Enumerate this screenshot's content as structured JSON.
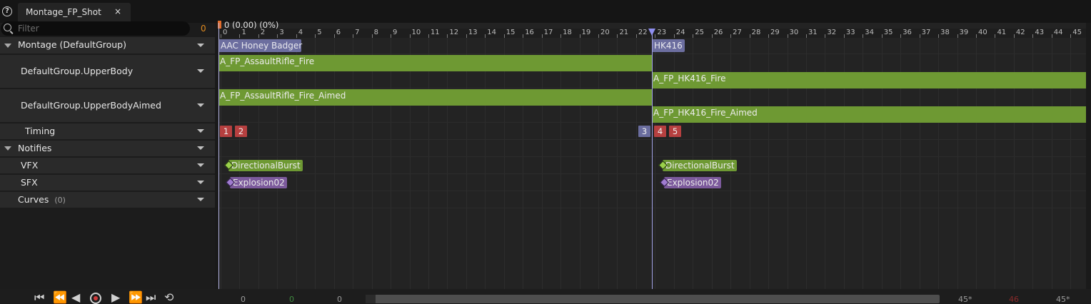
{
  "tab": {
    "title": "Montage_FP_Shot",
    "close": "×"
  },
  "help_icon": "?",
  "filter": {
    "placeholder": "Filter",
    "count": "0"
  },
  "tracks": [
    {
      "label": "Montage (DefaultGroup)"
    },
    {
      "label": "DefaultGroup.UpperBody"
    },
    {
      "label": "DefaultGroup.UpperBodyAimed"
    },
    {
      "label": "Timing"
    },
    {
      "label": "Notifies"
    },
    {
      "label": "VFX"
    },
    {
      "label": "SFX"
    },
    {
      "label": "Curves",
      "count": "(0)"
    }
  ],
  "timeline": {
    "readout": "0 (0.00) (0%)",
    "ticks": [
      "0",
      "1",
      "2",
      "3",
      "4",
      "5",
      "6",
      "7",
      "8",
      "9",
      "10",
      "11",
      "12",
      "13",
      "14",
      "15",
      "16",
      "17",
      "18",
      "19",
      "20",
      "21",
      "22",
      "23",
      "24",
      "25",
      "26",
      "27",
      "28",
      "29",
      "30",
      "31",
      "32",
      "33",
      "34",
      "35",
      "36",
      "37",
      "38",
      "39",
      "40",
      "41",
      "42",
      "43",
      "44",
      "45"
    ],
    "playhead_frame": 23
  },
  "sections": [
    "AAC Honey Badger",
    "HK416"
  ],
  "animations": {
    "upperbody": [
      "A_FP_AssaultRifle_Fire",
      "A_FP_HK416_Fire"
    ],
    "upperbody_aimed": [
      "A_FP_AssaultRifle_Fire_Aimed",
      "A_FP_HK416_Fire_Aimed"
    ]
  },
  "timing_markers": [
    "1",
    "2",
    "3",
    "4",
    "5"
  ],
  "notifies": {
    "vfx": [
      "DirectionalBurst",
      "DirectionalBurst"
    ],
    "sfx": [
      "Explosion02",
      "Explosion02"
    ]
  },
  "bottom": {
    "start": "0",
    "current": "0",
    "end": "0",
    "right_a": "45*",
    "right_b": "46",
    "right_c": "45*"
  },
  "colors": {
    "section": "#6c6e9f",
    "animation": "#6e9933",
    "marker_red": "#b64040",
    "marker_blue": "#6a6d9e",
    "vfx_notify": "#6e9933",
    "sfx_notify": "#7c5a9c",
    "filter_count": "#e08a1e",
    "playhead": "#a2a2e6"
  },
  "icons": [
    "help-icon",
    "close-icon",
    "search-icon",
    "collapse-arrow-icon",
    "dropdown-arrow-icon",
    "jump-to-start-icon",
    "step-back-icon",
    "play-reverse-icon",
    "record-icon",
    "play-icon",
    "step-forward-icon",
    "jump-to-end-icon",
    "loop-icon"
  ]
}
